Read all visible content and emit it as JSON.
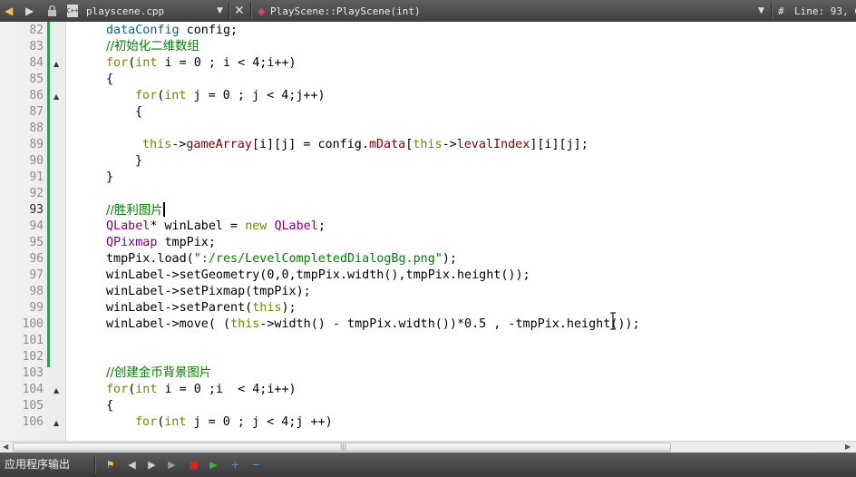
{
  "toolbar": {
    "back_icon": "arrow-left-icon",
    "forward_icon": "arrow-right-icon",
    "file_badge": "C++",
    "file_name": "playscene.cpp",
    "function_name": "PlayScene::PlayScene(int)",
    "hash": "#",
    "line_info": "Line: 93, C"
  },
  "editor": {
    "current_line": 93,
    "lines": [
      {
        "n": "82",
        "indent": 0,
        "tokens": [
          [
            "fn",
            "dataConfig"
          ],
          [
            "",
            " config;"
          ]
        ]
      },
      {
        "n": "83",
        "indent": 0,
        "tokens": [
          [
            "cm",
            "//初始化二维数组"
          ]
        ]
      },
      {
        "n": "84",
        "indent": 0,
        "fold": true,
        "tokens": [
          [
            "kw",
            "for"
          ],
          [
            "",
            "("
          ],
          [
            "kw",
            "int"
          ],
          [
            "",
            " i = 0 ; i < 4;i++)"
          ]
        ]
      },
      {
        "n": "85",
        "indent": 0,
        "tokens": [
          [
            "",
            "{"
          ]
        ]
      },
      {
        "n": "86",
        "indent": 4,
        "fold": true,
        "tokens": [
          [
            "kw",
            "for"
          ],
          [
            "",
            "("
          ],
          [
            "kw",
            "int"
          ],
          [
            "",
            " j = 0 ; j < 4;j++)"
          ]
        ]
      },
      {
        "n": "87",
        "indent": 4,
        "tokens": [
          [
            "",
            "{"
          ]
        ]
      },
      {
        "n": "88",
        "indent": 0,
        "tokens": []
      },
      {
        "n": "89",
        "indent": 5,
        "tokens": [
          [
            "kw",
            "this"
          ],
          [
            "",
            "->"
          ],
          [
            "mem",
            "gameArray"
          ],
          [
            "",
            "[i][j] = config."
          ],
          [
            "mem",
            "mData"
          ],
          [
            "",
            "["
          ],
          [
            "kw",
            "this"
          ],
          [
            "",
            "->"
          ],
          [
            "mem",
            "levalIndex"
          ],
          [
            "",
            "][i][j];"
          ]
        ]
      },
      {
        "n": "90",
        "indent": 4,
        "tokens": [
          [
            "",
            "}"
          ]
        ]
      },
      {
        "n": "91",
        "indent": 0,
        "tokens": [
          [
            "",
            "}"
          ]
        ]
      },
      {
        "n": "92",
        "indent": 0,
        "tokens": []
      },
      {
        "n": "93",
        "indent": 0,
        "cursor": true,
        "tokens": [
          [
            "cm",
            "//胜利图片"
          ]
        ]
      },
      {
        "n": "94",
        "indent": 0,
        "tokens": [
          [
            "ty",
            "QLabel"
          ],
          [
            "",
            "* winLabel = "
          ],
          [
            "kw",
            "new"
          ],
          [
            "",
            " "
          ],
          [
            "ty",
            "QLabel"
          ],
          [
            "",
            ";"
          ]
        ]
      },
      {
        "n": "95",
        "indent": 0,
        "tokens": [
          [
            "ty",
            "QPixmap"
          ],
          [
            "",
            " tmpPix;"
          ]
        ]
      },
      {
        "n": "96",
        "indent": 0,
        "tokens": [
          [
            "",
            "tmpPix.load("
          ],
          [
            "str",
            "\":/res/LevelCompletedDialogBg.png\""
          ],
          [
            "",
            ");"
          ]
        ]
      },
      {
        "n": "97",
        "indent": 0,
        "tokens": [
          [
            "",
            "winLabel->setGeometry(0,0,tmpPix.width(),tmpPix.height());"
          ]
        ]
      },
      {
        "n": "98",
        "indent": 0,
        "tokens": [
          [
            "",
            "winLabel->setPixmap(tmpPix);"
          ]
        ]
      },
      {
        "n": "99",
        "indent": 0,
        "tokens": [
          [
            "",
            "winLabel->setParent("
          ],
          [
            "kw",
            "this"
          ],
          [
            "",
            ");"
          ]
        ]
      },
      {
        "n": "100",
        "indent": 0,
        "tokens": [
          [
            "",
            "winLabel->move( ("
          ],
          [
            "kw",
            "this"
          ],
          [
            "",
            "->width() - tmpPix.width())*0.5 , -tmpPix.height());"
          ]
        ]
      },
      {
        "n": "101",
        "indent": 0,
        "tokens": []
      },
      {
        "n": "102",
        "indent": 0,
        "tokens": []
      },
      {
        "n": "103",
        "indent": 0,
        "tokens": [
          [
            "cm",
            "//创建金币背景图片"
          ]
        ]
      },
      {
        "n": "104",
        "indent": 0,
        "fold": true,
        "tokens": [
          [
            "kw",
            "for"
          ],
          [
            "",
            "("
          ],
          [
            "kw",
            "int"
          ],
          [
            "",
            " i = 0 ;i  < 4;i++)"
          ]
        ]
      },
      {
        "n": "105",
        "indent": 0,
        "tokens": [
          [
            "",
            "{"
          ]
        ]
      },
      {
        "n": "106",
        "indent": 4,
        "fold": true,
        "tokens": [
          [
            "kw",
            "for"
          ],
          [
            "",
            "("
          ],
          [
            "kw",
            "int"
          ],
          [
            "",
            " j = 0 ; j < 4;j ++)"
          ]
        ]
      }
    ]
  },
  "output": {
    "title": "应用程序输出",
    "buttons": [
      {
        "name": "clear-output-icon",
        "glyph": "⚑",
        "color": "#f0c040"
      },
      {
        "name": "previous-item-icon",
        "glyph": "◀",
        "color": "#cfcfcf"
      },
      {
        "name": "next-item-icon",
        "glyph": "▶",
        "color": "#cfcfcf"
      },
      {
        "name": "run-icon",
        "glyph": "▶",
        "color": "#9a9a9a"
      },
      {
        "name": "stop-icon",
        "glyph": "■",
        "color": "#e02020"
      },
      {
        "name": "attach-debugger-icon",
        "glyph": "▶",
        "color": "#3cb04a"
      },
      {
        "name": "zoom-in-icon",
        "glyph": "+",
        "color": "#4a9ae8"
      },
      {
        "name": "zoom-out-icon",
        "glyph": "−",
        "color": "#4a9ae8"
      }
    ]
  }
}
